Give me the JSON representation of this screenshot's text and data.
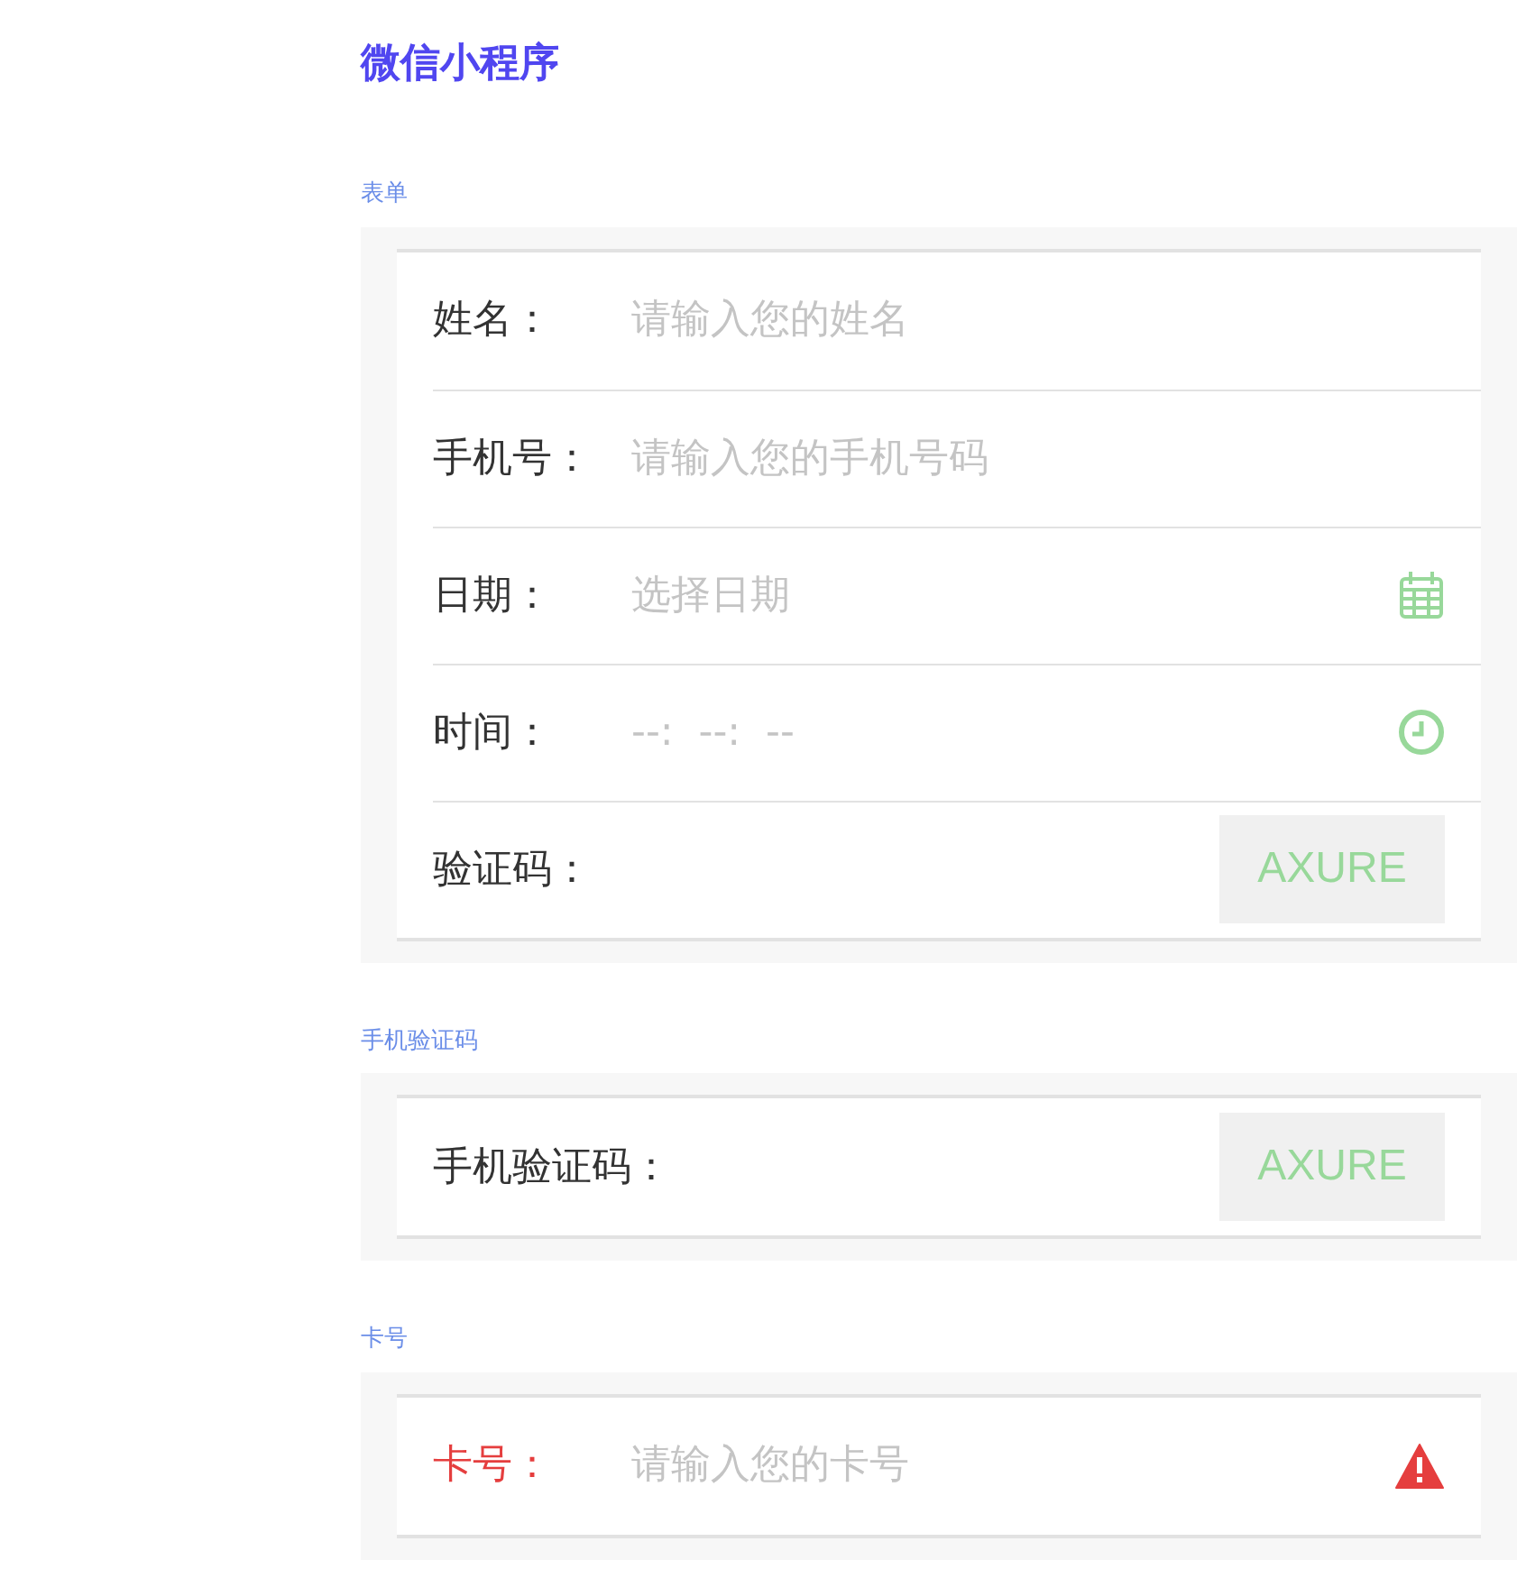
{
  "title": "微信小程序",
  "sections": [
    {
      "title": "表单",
      "rows": [
        {
          "kind": "input",
          "label": "姓名：",
          "placeholder": "请输入您的姓名",
          "error": false
        },
        {
          "kind": "input",
          "label": "手机号：",
          "placeholder": "请输入您的手机号码",
          "error": false
        },
        {
          "kind": "date",
          "label": "日期：",
          "placeholder": "选择日期",
          "error": false
        },
        {
          "kind": "time",
          "label": "时间：",
          "placeholder": "--:  --:  --",
          "error": false
        },
        {
          "kind": "captcha",
          "label": "验证码：",
          "button": "AXURE",
          "error": false
        }
      ]
    },
    {
      "title": "手机验证码",
      "rows": [
        {
          "kind": "captcha",
          "label": "手机验证码：",
          "button": "AXURE",
          "error": false
        }
      ]
    },
    {
      "title": "卡号",
      "rows": [
        {
          "kind": "input",
          "label": "卡号：",
          "placeholder": "请输入您的卡号",
          "error": true
        }
      ]
    }
  ]
}
